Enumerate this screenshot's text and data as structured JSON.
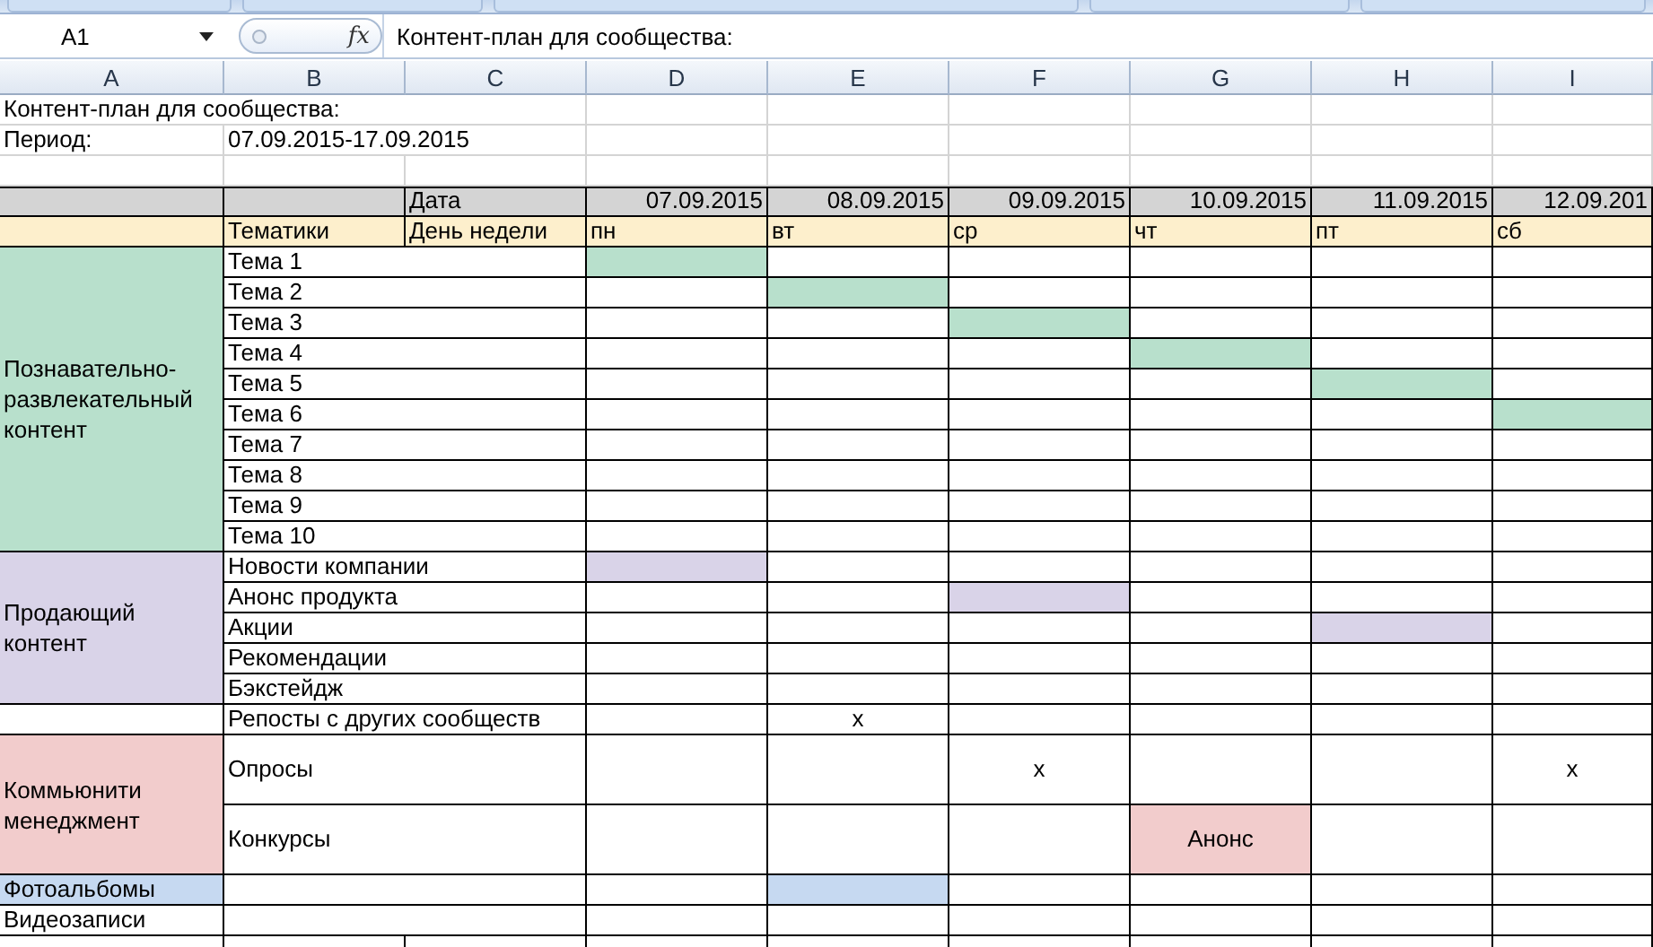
{
  "formula_bar": {
    "name_box": "A1",
    "function_button": "fx",
    "value": "Контент-план для сообщества:"
  },
  "columns": [
    "A",
    "B",
    "C",
    "D",
    "E",
    "F",
    "G",
    "H",
    "I"
  ],
  "title": "Контент-план для сообщества:",
  "period": {
    "label": "Период:",
    "value": "07.09.2015-17.09.2015"
  },
  "date_header": {
    "label": "Дата",
    "dates": [
      "07.09.2015",
      "08.09.2015",
      "09.09.2015",
      "10.09.2015",
      "11.09.2015",
      "12.09.201"
    ]
  },
  "weekday_header": {
    "topics_label": "Тематики",
    "label": "День недели",
    "days": [
      "пн",
      "вт",
      "ср",
      "чт",
      "пт",
      "сб"
    ]
  },
  "sections": [
    {
      "kind": "group",
      "label": "Познавательно-развлекательный контент",
      "color": "#b8e0cc",
      "rows": [
        {
          "kind": "normal",
          "topic": "Тема 1",
          "cells": [
            {
              "filled": true
            },
            {
              "filled": false
            },
            {
              "filled": false
            },
            {
              "filled": false
            },
            {
              "filled": false
            },
            {
              "filled": false
            }
          ]
        },
        {
          "kind": "normal",
          "topic": "Тема 2",
          "cells": [
            {
              "filled": false
            },
            {
              "filled": true
            },
            {
              "filled": false
            },
            {
              "filled": false
            },
            {
              "filled": false
            },
            {
              "filled": false
            }
          ]
        },
        {
          "kind": "normal",
          "topic": "Тема 3",
          "cells": [
            {
              "filled": false
            },
            {
              "filled": false
            },
            {
              "filled": true
            },
            {
              "filled": false
            },
            {
              "filled": false
            },
            {
              "filled": false
            }
          ]
        },
        {
          "kind": "normal",
          "topic": "Тема 4",
          "cells": [
            {
              "filled": false
            },
            {
              "filled": false
            },
            {
              "filled": false
            },
            {
              "filled": true
            },
            {
              "filled": false
            },
            {
              "filled": false
            }
          ]
        },
        {
          "kind": "normal",
          "topic": "Тема 5",
          "cells": [
            {
              "filled": false
            },
            {
              "filled": false
            },
            {
              "filled": false
            },
            {
              "filled": false
            },
            {
              "filled": true
            },
            {
              "filled": false
            }
          ]
        },
        {
          "kind": "normal",
          "topic": "Тема 6",
          "cells": [
            {
              "filled": false
            },
            {
              "filled": false
            },
            {
              "filled": false
            },
            {
              "filled": false
            },
            {
              "filled": false
            },
            {
              "filled": true
            }
          ]
        },
        {
          "kind": "normal",
          "topic": "Тема 7",
          "cells": [
            {
              "filled": false
            },
            {
              "filled": false
            },
            {
              "filled": false
            },
            {
              "filled": false
            },
            {
              "filled": false
            },
            {
              "filled": false
            }
          ]
        },
        {
          "kind": "normal",
          "topic": "Тема 8",
          "cells": [
            {
              "filled": false
            },
            {
              "filled": false
            },
            {
              "filled": false
            },
            {
              "filled": false
            },
            {
              "filled": false
            },
            {
              "filled": false
            }
          ]
        },
        {
          "kind": "normal",
          "topic": "Тема 9",
          "cells": [
            {
              "filled": false
            },
            {
              "filled": false
            },
            {
              "filled": false
            },
            {
              "filled": false
            },
            {
              "filled": false
            },
            {
              "filled": false
            }
          ]
        },
        {
          "kind": "normal",
          "topic": "Тема 10",
          "cells": [
            {
              "filled": false
            },
            {
              "filled": false
            },
            {
              "filled": false
            },
            {
              "filled": false
            },
            {
              "filled": false
            },
            {
              "filled": false
            }
          ]
        }
      ]
    },
    {
      "kind": "group",
      "label": "Продающий контент",
      "color": "#d9d3e8",
      "rows": [
        {
          "kind": "normal",
          "topic": "Новости компании",
          "cells": [
            {
              "filled": true
            },
            {
              "filled": false
            },
            {
              "filled": false
            },
            {
              "filled": false
            },
            {
              "filled": false
            },
            {
              "filled": false
            }
          ]
        },
        {
          "kind": "normal",
          "topic": "Анонс продукта",
          "cells": [
            {
              "filled": false
            },
            {
              "filled": false
            },
            {
              "filled": true
            },
            {
              "filled": false
            },
            {
              "filled": false
            },
            {
              "filled": false
            }
          ]
        },
        {
          "kind": "normal",
          "topic": "Акции",
          "cells": [
            {
              "filled": false
            },
            {
              "filled": false
            },
            {
              "filled": false
            },
            {
              "filled": false
            },
            {
              "filled": true
            },
            {
              "filled": false
            }
          ]
        },
        {
          "kind": "normal",
          "topic": "Рекомендации",
          "cells": [
            {
              "filled": false
            },
            {
              "filled": false
            },
            {
              "filled": false
            },
            {
              "filled": false
            },
            {
              "filled": false
            },
            {
              "filled": false
            }
          ]
        },
        {
          "kind": "normal",
          "topic": "Бэкстейдж",
          "cells": [
            {
              "filled": false
            },
            {
              "filled": false
            },
            {
              "filled": false
            },
            {
              "filled": false
            },
            {
              "filled": false
            },
            {
              "filled": false
            }
          ]
        }
      ]
    },
    {
      "kind": "group",
      "rows": [
        {
          "kind": "normal",
          "topic": "Репосты с других сообществ",
          "cells": [
            {
              "filled": false
            },
            {
              "filled": false,
              "text": "x"
            },
            {
              "filled": false
            },
            {
              "filled": false
            },
            {
              "filled": false
            },
            {
              "filled": false
            }
          ]
        }
      ]
    },
    {
      "kind": "group",
      "label": "Коммьюнити менеджмент",
      "color": "#f2cccc",
      "rows": [
        {
          "kind": "tall",
          "topic": "Опросы",
          "cells": [
            {
              "filled": false
            },
            {
              "filled": false
            },
            {
              "filled": false,
              "text": "x"
            },
            {
              "filled": false
            },
            {
              "filled": false
            },
            {
              "filled": false,
              "text": "x"
            }
          ]
        },
        {
          "kind": "tall",
          "topic": "Конкурсы",
          "cells": [
            {
              "filled": false
            },
            {
              "filled": false
            },
            {
              "filled": false
            },
            {
              "filled": true,
              "text": "Анонс"
            },
            {
              "filled": false
            },
            {
              "filled": false
            }
          ]
        }
      ]
    },
    {
      "kind": "item",
      "label": "Фотоальбомы",
      "color": "#c6d9f1",
      "cells": [
        {
          "filled": false
        },
        {
          "filled": true
        },
        {
          "filled": false
        },
        {
          "filled": false
        },
        {
          "filled": false
        },
        {
          "filled": false
        }
      ]
    },
    {
      "kind": "item",
      "label": "Видеозаписи",
      "cells": [
        {
          "filled": false
        },
        {
          "filled": false
        },
        {
          "filled": false
        },
        {
          "filled": false
        },
        {
          "filled": false
        },
        {
          "filled": false
        }
      ]
    }
  ]
}
